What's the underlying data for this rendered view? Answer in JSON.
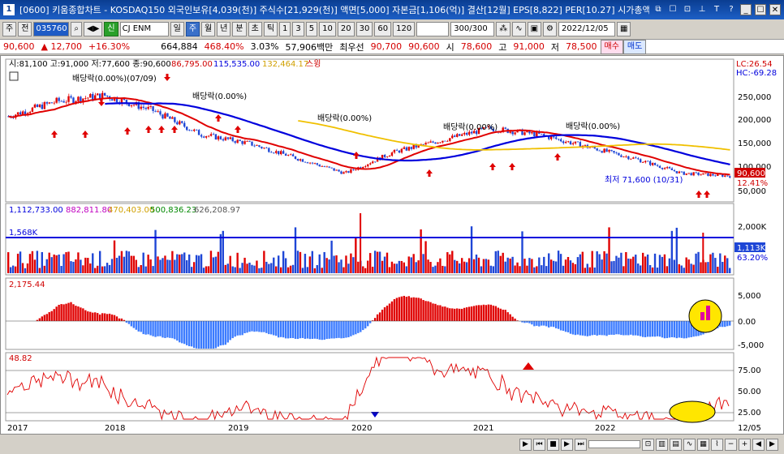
{
  "window": {
    "num": "1",
    "title": "[0600] 키움종합차트 - KOSDAQ150 외국인보유[4,039(천)] 주식수[21,929(천)] 액면[5,000] 자본금[1,106(억)] 결산[12월] EPS[8,822] PER[10.27] 시가총액[19",
    "controls": [
      "⧉",
      "☐",
      "⊡",
      "⊥",
      "T",
      "?",
      "_",
      "☐",
      "✕"
    ]
  },
  "toolbar": {
    "mode": "주",
    "mode2": "전",
    "code": "035760",
    "badge": "신",
    "stock_name": "CJ ENM",
    "periods": [
      "일",
      "주",
      "월",
      "년",
      "분",
      "초",
      "틱"
    ],
    "selected_period": "주",
    "intervals": [
      "1",
      "3",
      "5",
      "10",
      "20",
      "30",
      "60",
      "120"
    ],
    "count": "300/300",
    "date": "2022/12/05"
  },
  "pricebar": {
    "price": "90,600",
    "change": "▲ 12,700",
    "change_pct": "+16.30%",
    "volume": "664,884",
    "vol_ratio": "468.40%",
    "turnover": "3.03%",
    "amount": "57,906백만",
    "best_label": "최우선",
    "ask": "90,700",
    "bid": "90,600",
    "open_label": "시",
    "open": "78,600",
    "high_label": "고",
    "high": "91,000",
    "low_label": "저",
    "low": "78,500",
    "buy": "매수",
    "sell": "매도"
  },
  "colors": {
    "up": "#e00000",
    "down": "#1e46d6",
    "ma_short": "#e00000",
    "ma_mid": "#0000dd",
    "ma_long": "#f0c000",
    "vol_line": "#0000dd",
    "macd_hist_up": "#e00000",
    "macd_hist_down": "#3b7bff",
    "cci": "#e00000",
    "highlight": "#ffe600"
  },
  "panes": {
    "price": {
      "legend": {
        "ohlc": "시:81,100 고:91,000 저:77,600 종:90,600",
        "ma1": "86,795.00",
        "ma2": "115,535.00",
        "ma3": "132,464.17",
        "swing": "스윙"
      },
      "lc": "LC:26.54",
      "hc": "HC:-69.28",
      "ticks": [
        "250,000",
        "200,000",
        "150,000",
        "100,000",
        "50,000"
      ],
      "last_price": "90,600",
      "last_pct": "12.41%",
      "annotations": [
        "배당락(0.00%)(07/09)",
        "배당락(0.00%)",
        "배당락(0.00%)",
        "배당락(0.00%)",
        "배당락(0.00%)"
      ],
      "low_text": "최저 71,600 (10/31)"
    },
    "volume": {
      "legend": {
        "v1": "1,112,733.00",
        "v2": "882,811.80",
        "v3": "470,403.00",
        "v4": "500,836.23",
        "v5": "626,208.97"
      },
      "hline_label": "1,568K",
      "ticks": [
        "2,000K"
      ],
      "last_vol": "1,113K",
      "last_pct": "63.20%"
    },
    "macd": {
      "legend": "2,175.44",
      "ticks": [
        "5,000",
        "0.00",
        "-5,000"
      ]
    },
    "cci": {
      "legend": "48.82",
      "ticks": [
        "75.00",
        "50.00",
        "25.00"
      ]
    }
  },
  "xaxis": {
    "labels": [
      "2017",
      "2018",
      "2019",
      "2020",
      "2021",
      "2022"
    ],
    "last": "12/05"
  },
  "chart_data": {
    "type": "line",
    "title": "",
    "x": [
      "2017",
      "2018",
      "2019",
      "2020",
      "2021",
      "2022"
    ],
    "series": [
      {
        "values": [
          190000,
          215000,
          225000,
          200000,
          160000,
          145000,
          120000,
          95000,
          130000,
          150000,
          170000,
          160000,
          140000,
          120000,
          95000,
          90600
        ]
      }
    ],
    "ylim": [
      50000,
      280000
    ]
  }
}
